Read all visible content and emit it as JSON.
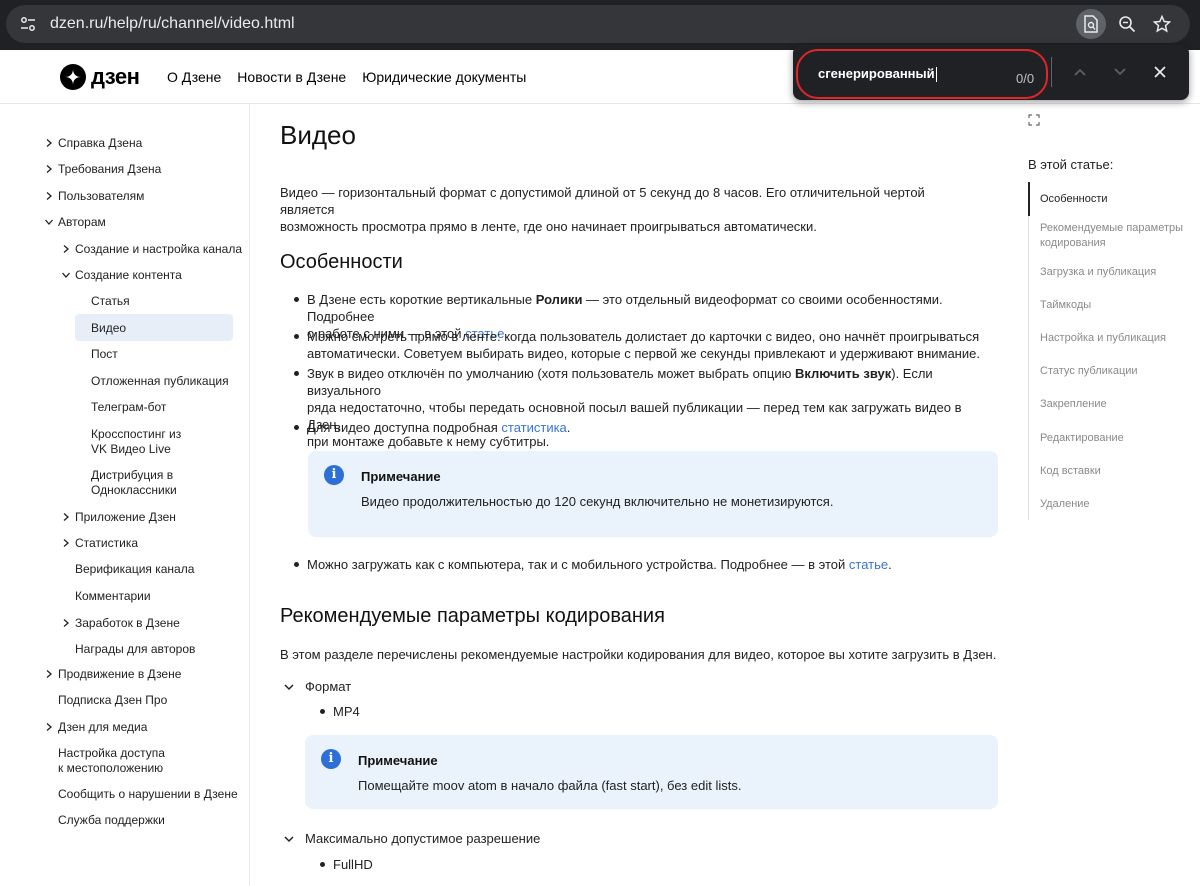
{
  "browser": {
    "url": "dzen.ru/help/ru/channel/video.html"
  },
  "header": {
    "logo_text": "дзен",
    "nav": [
      "О Дзене",
      "Новости в Дзене",
      "Юридические документы"
    ]
  },
  "findbar": {
    "query": "сгенерированный",
    "count": "0/0"
  },
  "sidebar": {
    "items": [
      {
        "label": "Справка Дзена",
        "chev": "right"
      },
      {
        "label": "Требования Дзена",
        "chev": "right"
      },
      {
        "label": "Пользователям",
        "chev": "right"
      },
      {
        "label": "Авторам",
        "chev": "down"
      },
      {
        "label": "Создание и настройка канала",
        "chev": "right"
      },
      {
        "label": "Создание контента",
        "chev": "down"
      },
      {
        "label": "Статья"
      },
      {
        "label": "Видео",
        "active": true
      },
      {
        "label": "Пост"
      },
      {
        "label": "Отложенная публикация"
      },
      {
        "label": "Телеграм-бот"
      },
      {
        "label": "Кросспостинг из\nVK Видео Live"
      },
      {
        "label": "Дистрибуция в\nОдноклассники"
      },
      {
        "label": "Приложение Дзен",
        "chev": "right"
      },
      {
        "label": "Статистика",
        "chev": "right"
      },
      {
        "label": "Верификация канала"
      },
      {
        "label": "Комментарии"
      },
      {
        "label": "Заработок в Дзене",
        "chev": "right"
      },
      {
        "label": "Награды для авторов"
      },
      {
        "label": "Продвижение в Дзене",
        "chev": "right"
      },
      {
        "label": "Подписка Дзен Про"
      },
      {
        "label": "Дзен для медиа",
        "chev": "right"
      },
      {
        "label": "Настройка доступа\nк местоположению"
      },
      {
        "label": "Сообщить о нарушении в Дзене"
      },
      {
        "label": "Служба поддержки"
      }
    ]
  },
  "article": {
    "title": "Видео",
    "intro_1": "Видео — горизонтальный формат с допустимой длиной от 5 секунд до 8 часов. Его отличительной чертой является",
    "intro_2": "возможность просмотра прямо в ленте, где оно начинает проигрываться автоматически.",
    "h_features": "Особенности",
    "b1_pre": "В Дзене есть короткие вертикальные ",
    "b1_bold": "Ролики",
    "b1_post": " — это отдельный видеоформат со своими особенностями. Подробнее",
    "b1_line2_pre": "о работе с ними — в этой ",
    "b1_link": "статье",
    "b1_end": ".",
    "b2_1": "Можно смотреть прямо в ленте: когда пользователь долистает до карточки с видео, оно начнёт проигрываться",
    "b2_2": "автоматически. Советуем выбирать видео, которые с первой же секунды привлекают и удерживают внимание.",
    "b3_pre": "Звук в видео отключён по умолчанию (хотя пользователь может выбрать опцию ",
    "b3_bold": "Включить звук",
    "b3_post": "). Если визуального",
    "b3_2": "ряда недостаточно, чтобы передать основной посыл вашей публикации — перед тем как загружать видео в Дзен,",
    "b3_3": "при монтаже добавьте к нему субтитры.",
    "b4_pre": "Для видео доступна подробная ",
    "b4_link": "статистика",
    "b4_end": ".",
    "note1_title": "Примечание",
    "note1_body": "Видео продолжительностью до 120 секунд включительно не монетизируются.",
    "b5_pre": "Можно загружать как с компьютера, так и с мобильного устройства. Подробнее — в этой ",
    "b5_link": "статье",
    "b5_end": ".",
    "h_encoding": "Рекомендуемые параметры кодирования",
    "enc_intro": "В этом разделе перечислены рекомендуемые настройки кодирования для видео, которое вы хотите загрузить в Дзен.",
    "acc1": "Формат",
    "acc1_item": "MP4",
    "note2_title": "Примечание",
    "note2_body": "Помещайте moov atom в начало файла (fast start), без edit lists.",
    "acc2": "Максимально допустимое разрешение",
    "acc2_item": "FullHD",
    "info_glyph": "i"
  },
  "toc": {
    "title": "В этой статье:",
    "items": [
      "Особенности",
      "Рекомендуемые параметры кодирования",
      "Загрузка и публикация",
      "Таймкоды",
      "Настройка и публикация",
      "Статус публикации",
      "Закрепление",
      "Редактирование",
      "Код вставки",
      "Удаление"
    ]
  },
  "colors": {
    "link": "#3a73d6",
    "note_bg": "#eaf2fb",
    "find_highlight": "#e0262b",
    "active_sidebar_bg": "#e8eef8"
  }
}
